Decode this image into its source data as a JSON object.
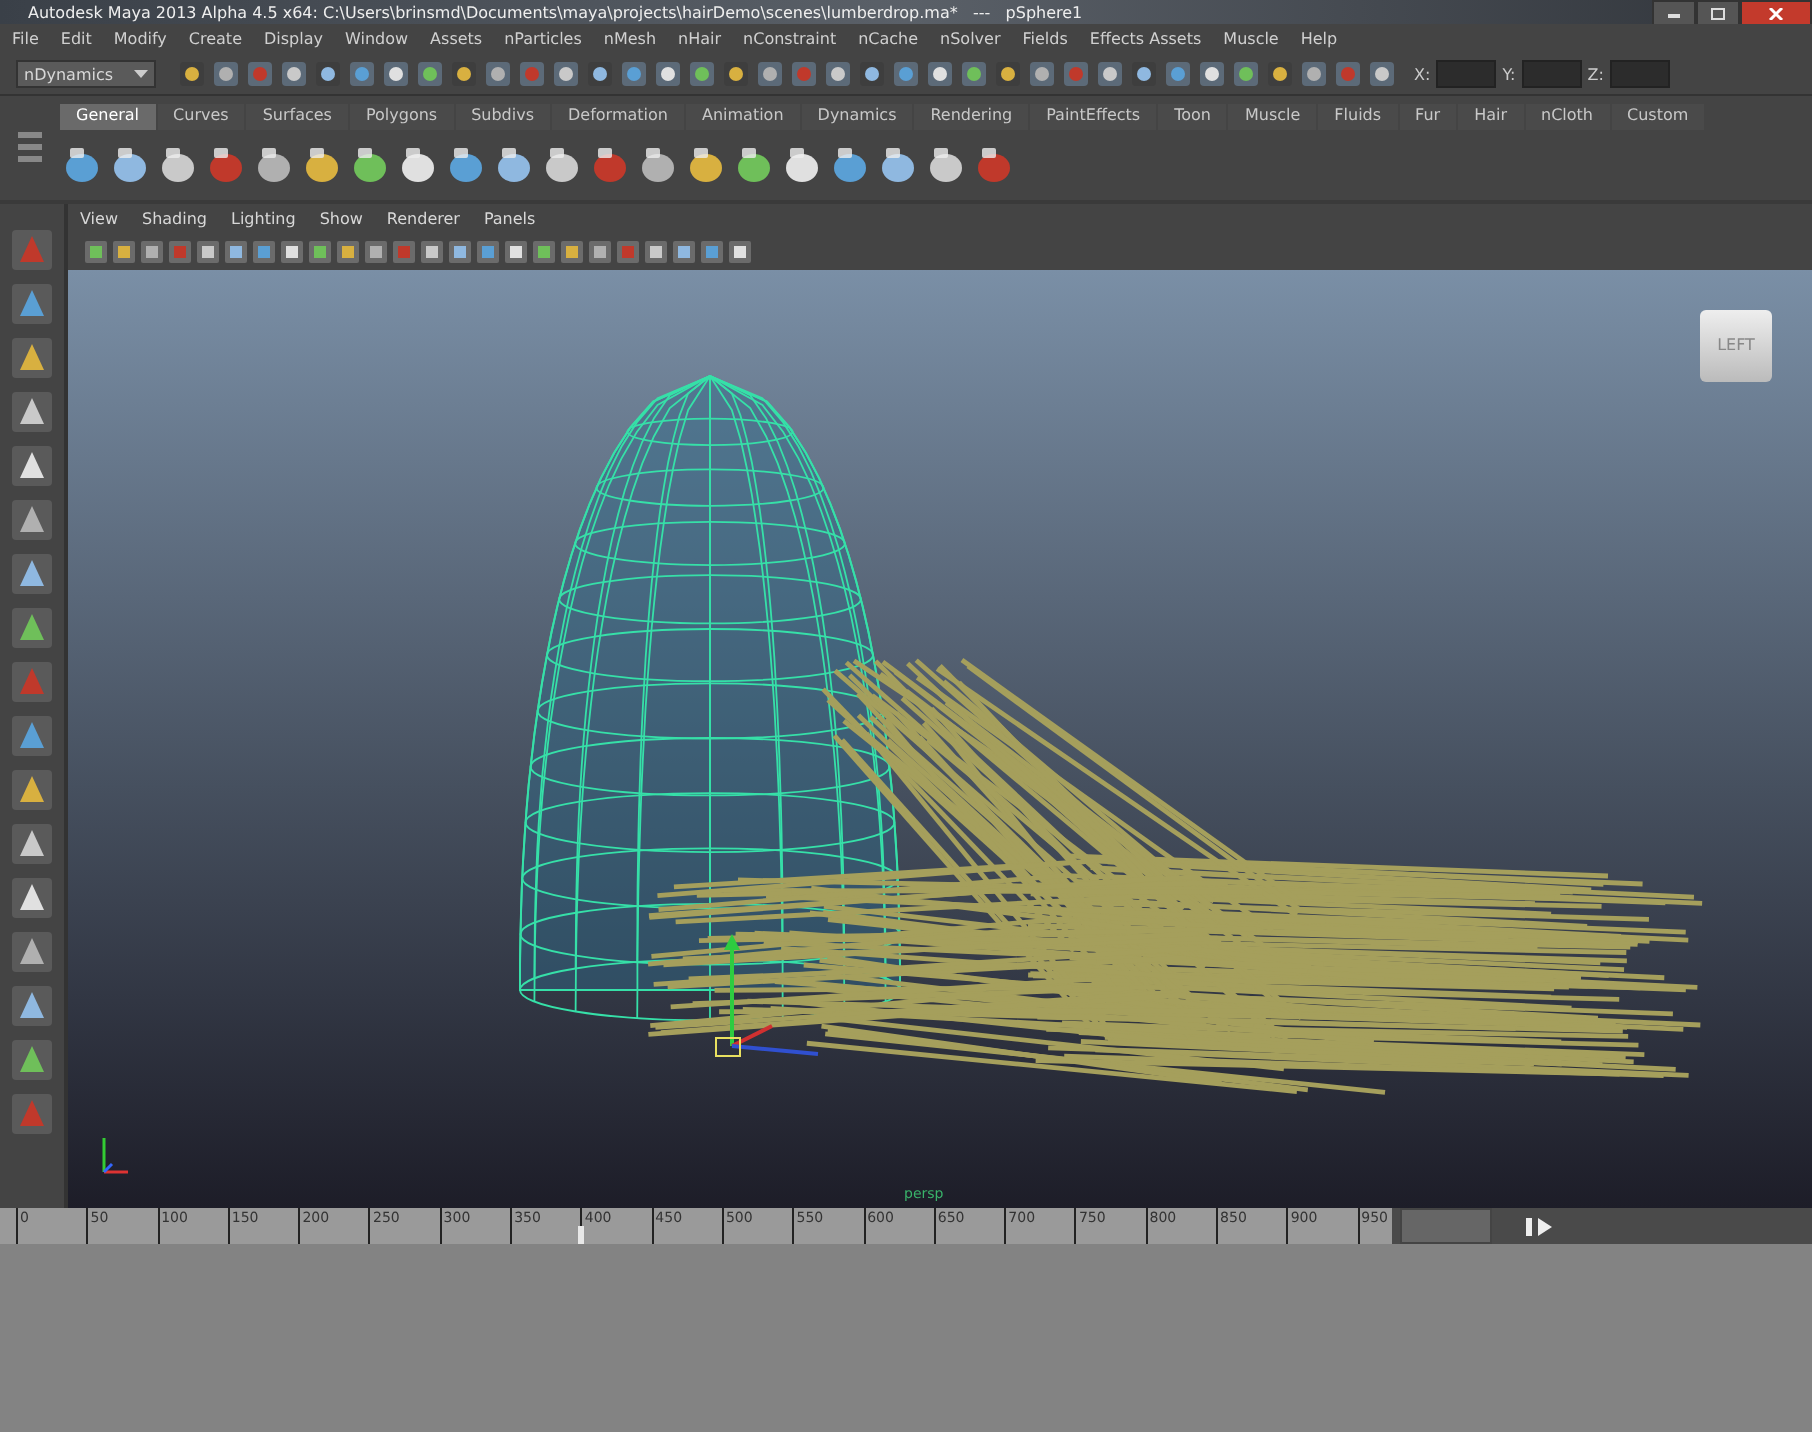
{
  "window": {
    "title": "Autodesk Maya 2013 Alpha 4.5 x64: C:\\Users\\brinsmd\\Documents\\maya\\projects\\hairDemo\\scenes\\lumberdrop.ma*   ---   pSphere1"
  },
  "menu_bar": [
    "File",
    "Edit",
    "Modify",
    "Create",
    "Display",
    "Window",
    "Assets",
    "nParticles",
    "nMesh",
    "nHair",
    "nConstraint",
    "nCache",
    "nSolver",
    "Fields",
    "Effects Assets",
    "Muscle",
    "Help"
  ],
  "status_line": {
    "menu_set": "nDynamics",
    "coordinate_labels": [
      "X:",
      "Y:",
      "Z:"
    ]
  },
  "shelf": {
    "tabs": [
      {
        "label": "General",
        "selected": true
      },
      {
        "label": "Curves",
        "selected": false
      },
      {
        "label": "Surfaces",
        "selected": false
      },
      {
        "label": "Polygons",
        "selected": false
      },
      {
        "label": "Subdivs",
        "selected": false
      },
      {
        "label": "Deformation",
        "selected": false
      },
      {
        "label": "Animation",
        "selected": false
      },
      {
        "label": "Dynamics",
        "selected": false
      },
      {
        "label": "Rendering",
        "selected": false
      },
      {
        "label": "PaintEffects",
        "selected": false
      },
      {
        "label": "Toon",
        "selected": false
      },
      {
        "label": "Muscle",
        "selected": false
      },
      {
        "label": "Fluids",
        "selected": false
      },
      {
        "label": "Fur",
        "selected": false
      },
      {
        "label": "Hair",
        "selected": false
      },
      {
        "label": "nCloth",
        "selected": false
      },
      {
        "label": "Custom",
        "selected": false
      }
    ]
  },
  "panel": {
    "menus": [
      "View",
      "Shading",
      "Lighting",
      "Show",
      "Renderer",
      "Panels"
    ],
    "view_cube_label": "LEFT",
    "camera": "persp"
  },
  "time_slider": {
    "level": 0.41,
    "ticks": [
      "0",
      "50",
      "100",
      "150",
      "200",
      "250",
      "300",
      "350",
      "400",
      "450",
      "500",
      "550",
      "600",
      "650",
      "700",
      "750",
      "800",
      "850",
      "900",
      "950"
    ]
  }
}
